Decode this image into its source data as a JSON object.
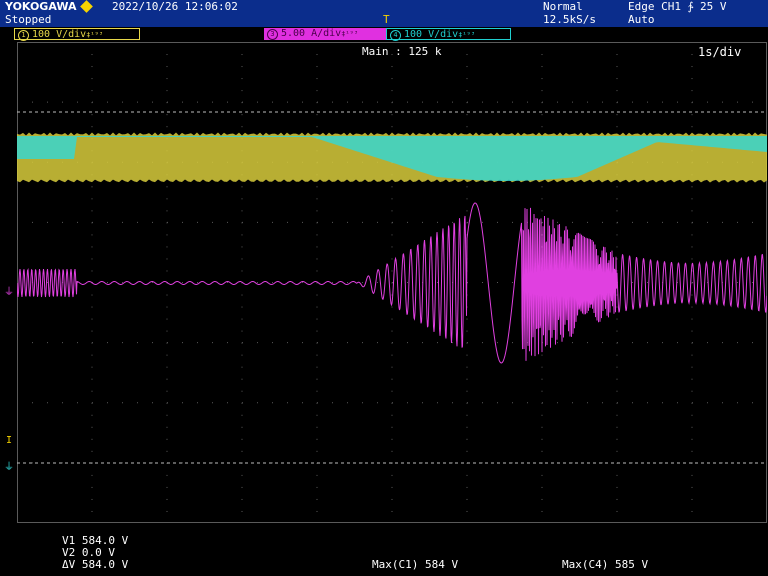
{
  "header": {
    "brand": "YOKOGAWA",
    "datetime": "2022/10/26 12:06:02",
    "status": "Stopped",
    "trig_mode": "Normal",
    "sample_rate": "12.5kS/s",
    "trigger": "Edge CH1 ∱ 25 V",
    "trig_level_icon": "trigger-edge-rising-icon",
    "auto": "Auto",
    "trigger_pos_marker": "T"
  },
  "channels": [
    {
      "num": "1",
      "label": "100 V/div",
      "suffix": "‡¹⁹³",
      "color": "#e8d84a",
      "bg": "#000000",
      "border": "#e8d84a"
    },
    {
      "num": "3",
      "label": "5.00 A/div",
      "suffix": "‡¹⁹³",
      "color": "#d020d0",
      "bg": "#e030e0",
      "text": "#5a005a",
      "border": "#e030e0"
    },
    {
      "num": "4",
      "label": "100 V/div",
      "suffix": "‡¹⁹³",
      "color": "#20d0d0",
      "bg": "#000000",
      "border": "#20d0d0"
    }
  ],
  "main_label": "Main : 125 k",
  "timebase": "1s/div",
  "cursor": {
    "v1": "V1   584.0 V",
    "v2": "V2   0.0 V",
    "dv": "ΔV  584.0 V"
  },
  "measurements": {
    "max_c1": "Max(C1)  584 V",
    "max_c4": "Max(C4)  585 V"
  },
  "colors": {
    "ch1": "#d8cc3c",
    "ch3": "#e040e0",
    "ch4": "#30d8d8",
    "grid": "#5a5a5a",
    "bar": "#0b2d8c"
  }
}
